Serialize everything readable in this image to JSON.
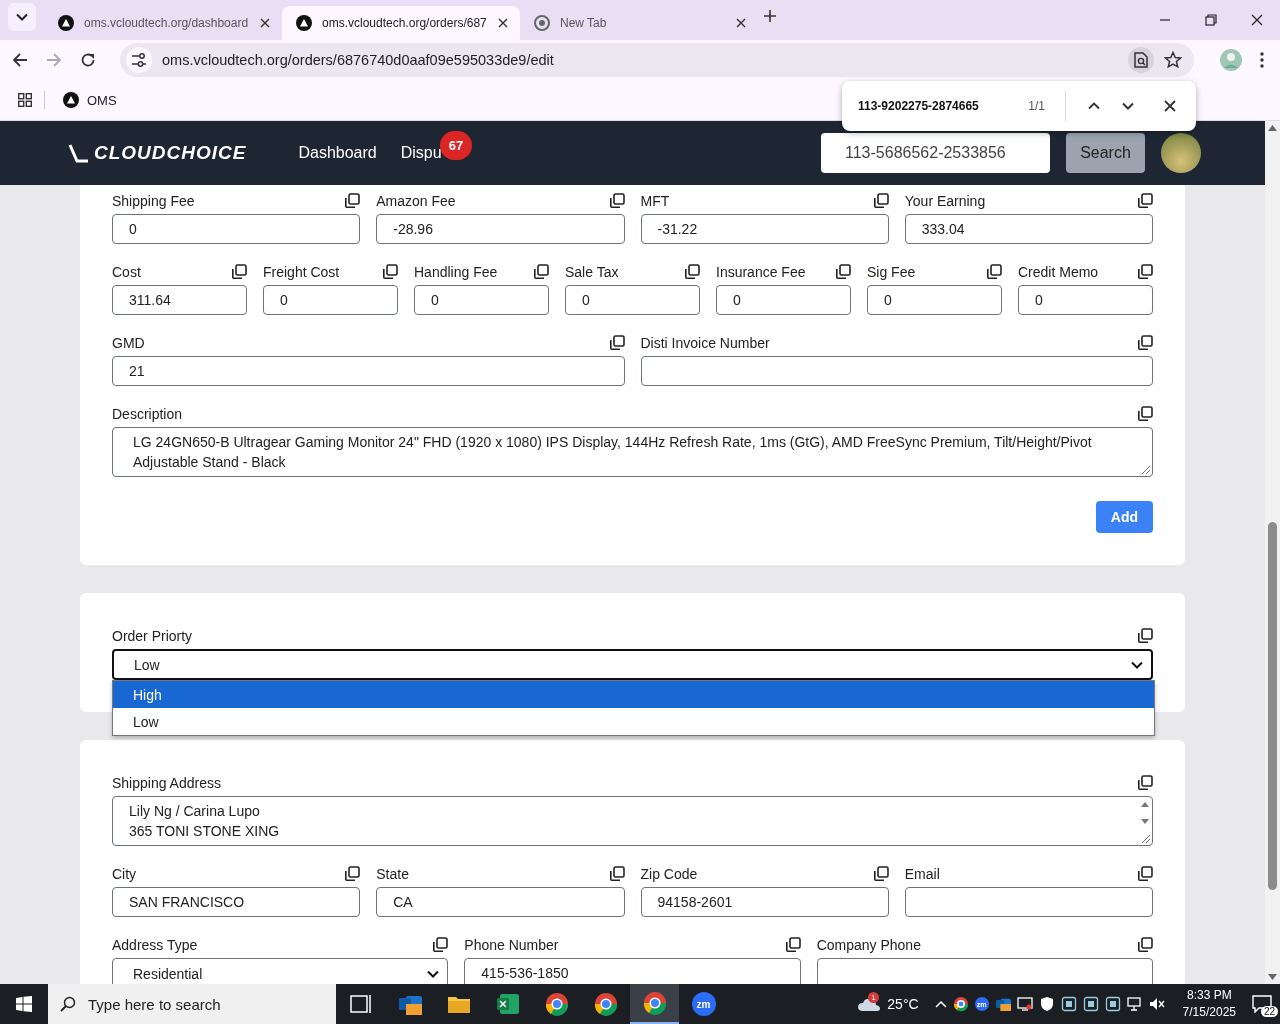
{
  "browser": {
    "tabs": [
      {
        "title": "oms.vcloudtech.org/dashboard",
        "kind": "site",
        "selected": false
      },
      {
        "title": "oms.vcloudtech.org/orders/687",
        "kind": "site",
        "selected": true
      },
      {
        "title": "New Tab",
        "kind": "newtab",
        "selected": false
      }
    ],
    "url": "oms.vcloudtech.org/orders/6876740d0aaf09e595033de9/edit",
    "bookmarks": [
      {
        "label": "OMS"
      }
    ],
    "find_bar": {
      "query": "113-9202275-2874665",
      "count": "1/1"
    }
  },
  "navbar": {
    "logo": "CLOUDCHOICE",
    "links": [
      {
        "label": "Dashboard"
      },
      {
        "label": "Dispu",
        "badge": "67"
      }
    ],
    "search": {
      "value": "113-5686562-2533856",
      "button": "Search"
    }
  },
  "cards": [
    {
      "rows": [
        {
          "fields": [
            {
              "label": "Shipping Fee",
              "kind": "input",
              "value": "0"
            },
            {
              "label": "Amazon Fee",
              "kind": "input",
              "value": "-28.96"
            },
            {
              "label": "MFT",
              "kind": "input",
              "value": "-31.22"
            },
            {
              "label": "Your Earning",
              "kind": "input",
              "value": "333.04"
            }
          ]
        },
        {
          "fields": [
            {
              "label": "Cost",
              "kind": "input",
              "value": "311.64"
            },
            {
              "label": "Freight Cost",
              "kind": "input",
              "value": "0"
            },
            {
              "label": "Handling Fee",
              "kind": "input",
              "value": "0"
            },
            {
              "label": "Sale Tax",
              "kind": "input",
              "value": "0"
            },
            {
              "label": "Insurance Fee",
              "kind": "input",
              "value": "0"
            },
            {
              "label": "Sig Fee",
              "kind": "input",
              "value": "0"
            },
            {
              "label": "Credit Memo",
              "kind": "input",
              "value": "0"
            }
          ]
        },
        {
          "fields": [
            {
              "label": "GMD",
              "kind": "input",
              "value": "21"
            },
            {
              "label": "Disti Invoice Number",
              "kind": "input"
            }
          ]
        },
        {
          "fields": [
            {
              "label": "Description",
              "kind": "textarea",
              "scrollbar": false,
              "value": "LG 24GN650-B Ultragear Gaming Monitor 24\" FHD (1920 x 1080) IPS Display, 144Hz Refresh Rate, 1ms (GtG), AMD FreeSync Premium, Tilt/Height/Pivot Adjustable Stand - Black"
            }
          ]
        }
      ],
      "button": "Add"
    },
    {
      "rows": [
        {
          "fields": [
            {
              "label": "Order Priorty",
              "kind": "select",
              "value": "Low",
              "expanded": true,
              "options": [
                {
                  "label": "High",
                  "highlighted": true
                },
                {
                  "label": "Low",
                  "highlighted": false
                }
              ]
            }
          ]
        }
      ]
    },
    {
      "rows": [
        {
          "fields": [
            {
              "label": "Shipping Address",
              "kind": "textarea",
              "scrollbar": true,
              "value": "Lily Ng / Carina Lupo\n365 TONI STONE XING"
            }
          ]
        },
        {
          "fields": [
            {
              "label": "City",
              "kind": "input",
              "value": "SAN FRANCISCO"
            },
            {
              "label": "State",
              "kind": "input",
              "value": "CA"
            },
            {
              "label": "Zip Code",
              "kind": "input",
              "value": "94158-2601"
            },
            {
              "label": "Email",
              "kind": "input"
            }
          ]
        },
        {
          "fields": [
            {
              "label": "Address Type",
              "kind": "select",
              "value": "Residential",
              "expanded": false
            },
            {
              "label": "Phone Number",
              "kind": "input",
              "value": "415-536-1850"
            },
            {
              "label": "Company Phone",
              "kind": "input"
            }
          ]
        }
      ]
    }
  ],
  "taskbar": {
    "search_placeholder": "Type here to search",
    "apps": [
      {
        "kind": "task-view",
        "selected": false
      },
      {
        "kind": "mail",
        "selected": false
      },
      {
        "kind": "folder",
        "selected": false
      },
      {
        "kind": "spreadsheet",
        "selected": false
      },
      {
        "kind": "browser",
        "selected": false
      },
      {
        "kind": "browser",
        "selected": false
      },
      {
        "kind": "browser",
        "selected": true
      },
      {
        "kind": "meeting",
        "label": "zm",
        "selected": false
      }
    ],
    "weather": {
      "temp": "25°C",
      "badge": "1"
    },
    "tray": [
      {
        "kind": "chevron"
      },
      {
        "kind": "browser"
      },
      {
        "kind": "meeting",
        "label": "zm"
      },
      {
        "kind": "mail"
      },
      {
        "kind": "display"
      },
      {
        "kind": "shield"
      },
      {
        "kind": "app"
      },
      {
        "kind": "app"
      },
      {
        "kind": "app"
      },
      {
        "kind": "network"
      },
      {
        "kind": "speaker"
      }
    ],
    "time": "8:33 PM",
    "date": "7/15/2025",
    "notifications": "22"
  }
}
